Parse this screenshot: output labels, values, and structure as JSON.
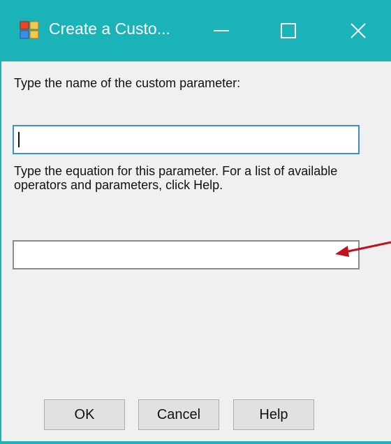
{
  "window": {
    "title": "Create a Custo...",
    "accent_color": "#19b3b8",
    "controls": {
      "minimize_icon": "minimize-icon",
      "maximize_icon": "maximize-icon",
      "close_icon": "close-icon"
    }
  },
  "dialog": {
    "name_prompt": "Type the name of the custom parameter:",
    "name_value": "",
    "equation_prompt": "Type the equation for this parameter.  For a list of available operators and parameters, click Help.",
    "equation_value": ""
  },
  "annotation": {
    "arrow_color": "#c0121c"
  },
  "buttons": {
    "ok_label": "OK",
    "cancel_label": "Cancel",
    "help_label": "Help"
  }
}
